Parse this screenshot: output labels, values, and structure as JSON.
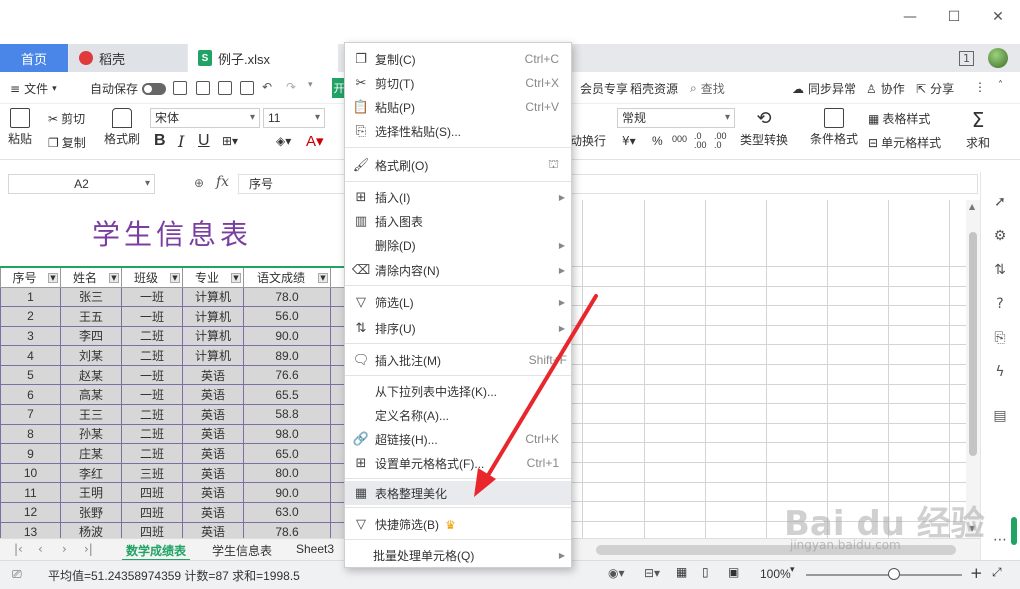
{
  "tabs": {
    "home": "首页",
    "docer": "稻壳",
    "file": "例子.xlsx",
    "page_indicator": "1"
  },
  "menu": {
    "file": "文件",
    "autosave": "自动保存",
    "start": "开",
    "vip": "会员专享",
    "docer_res": "稻壳资源",
    "search": "查找",
    "sync": "同步异常",
    "collab": "协作",
    "share": "分享"
  },
  "ribbon": {
    "paste": "粘贴",
    "cut": "剪切",
    "copy": "复制",
    "format_painter": "格式刷",
    "font": "宋体",
    "size": "11",
    "wrap": "动换行",
    "number_format": "常规",
    "type_convert": "类型转换",
    "cond_format": "条件格式",
    "table_style": "表格样式",
    "cell_style": "单元格样式",
    "sum": "求和"
  },
  "formula": {
    "namebox": "A2",
    "fx": "fx",
    "content": "序号"
  },
  "sheet": {
    "title": "学生信息表",
    "headers": [
      "序号",
      "姓名",
      "班级",
      "专业",
      "语文成绩"
    ],
    "rows": [
      [
        "1",
        "张三",
        "一班",
        "计算机",
        "78.0"
      ],
      [
        "2",
        "王五",
        "一班",
        "计算机",
        "56.0"
      ],
      [
        "3",
        "李四",
        "二班",
        "计算机",
        "90.0"
      ],
      [
        "4",
        "刘某",
        "二班",
        "计算机",
        "89.0"
      ],
      [
        "5",
        "赵某",
        "一班",
        "英语",
        "76.6"
      ],
      [
        "6",
        "高某",
        "一班",
        "英语",
        "65.5"
      ],
      [
        "7",
        "王三",
        "二班",
        "英语",
        "58.8"
      ],
      [
        "8",
        "孙某",
        "二班",
        "英语",
        "98.0"
      ],
      [
        "9",
        "庄某",
        "二班",
        "英语",
        "65.0"
      ],
      [
        "10",
        "李红",
        "三班",
        "英语",
        "80.0"
      ],
      [
        "11",
        "王明",
        "四班",
        "英语",
        "90.0"
      ],
      [
        "12",
        "张野",
        "四班",
        "英语",
        "63.0"
      ],
      [
        "13",
        "杨波",
        "四班",
        "英语",
        "78.6"
      ]
    ]
  },
  "sheet_tabs": [
    "数学成绩表",
    "学生信息表",
    "Sheet3"
  ],
  "status": {
    "summary": "平均值=51.24358974359  计数=87  求和=1998.5",
    "zoom": "100%"
  },
  "context_menu": {
    "copy": {
      "label": "复制(C)",
      "shortcut": "Ctrl+C"
    },
    "cut": {
      "label": "剪切(T)",
      "shortcut": "Ctrl+X"
    },
    "paste": {
      "label": "粘贴(P)",
      "shortcut": "Ctrl+V"
    },
    "paste_special": {
      "label": "选择性粘贴(S)..."
    },
    "format_painter": {
      "label": "格式刷(O)"
    },
    "insert": {
      "label": "插入(I)"
    },
    "insert_chart": {
      "label": "插入图表"
    },
    "delete": {
      "label": "删除(D)"
    },
    "clear": {
      "label": "清除内容(N)"
    },
    "filter": {
      "label": "筛选(L)"
    },
    "sort": {
      "label": "排序(U)"
    },
    "insert_comment": {
      "label": "插入批注(M)",
      "shortcut": "Shift+F"
    },
    "pick_from_list": {
      "label": "从下拉列表中选择(K)..."
    },
    "define_name": {
      "label": "定义名称(A)..."
    },
    "hyperlink": {
      "label": "超链接(H)...",
      "shortcut": "Ctrl+K"
    },
    "format_cells": {
      "label": "设置单元格格式(F)...",
      "shortcut": "Ctrl+1"
    },
    "beautify": {
      "label": "表格整理美化"
    },
    "quick_filter": {
      "label": "快捷筛选(B)"
    },
    "batch": {
      "label": "批量处理单元格(Q)"
    }
  },
  "watermark": {
    "brand": "Bai du 经验",
    "url": "jingyan.baidu.com"
  },
  "colors": {
    "accent_green": "#21a366",
    "home_tab_blue": "#4a86e8",
    "title_purple": "#7a3ea3",
    "arrow_red": "#e8262b"
  }
}
